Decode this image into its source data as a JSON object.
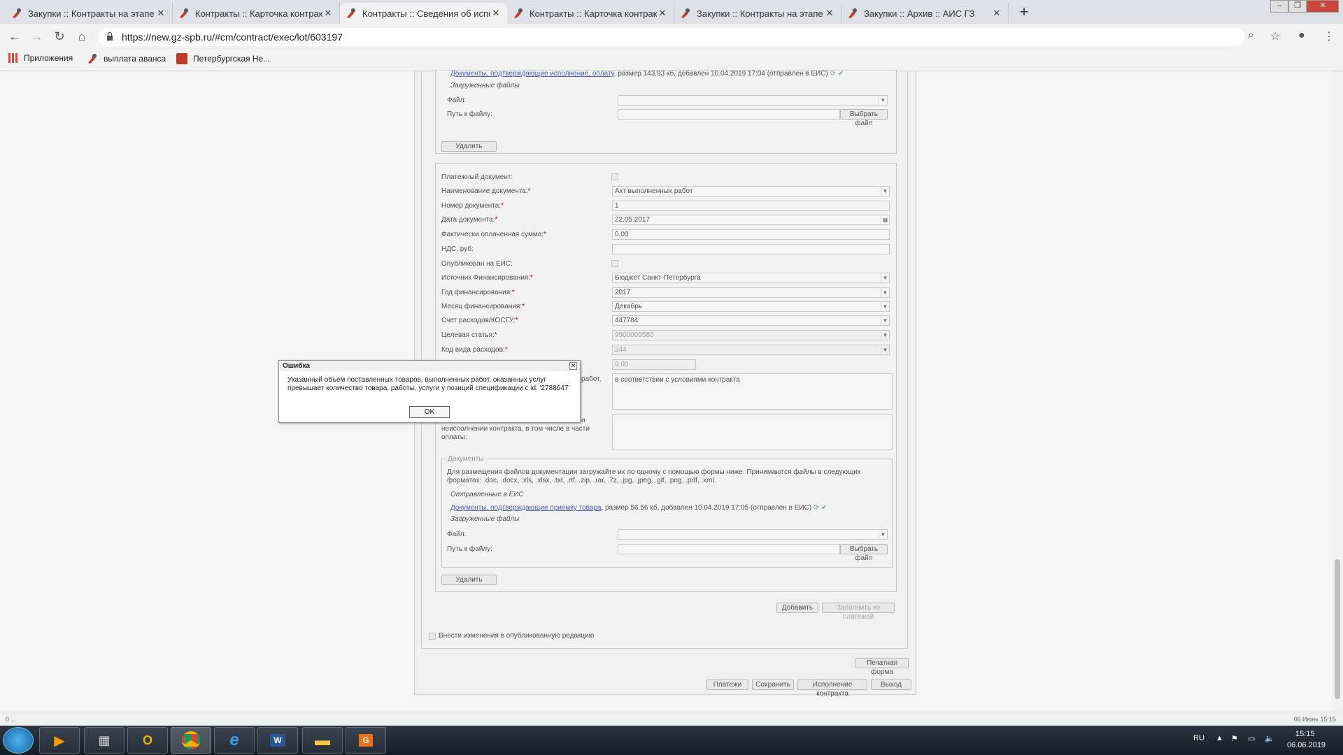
{
  "browser": {
    "tabs": [
      {
        "title": "Закупки :: Контракты на этапе и",
        "active": false
      },
      {
        "title": "Контракты :: Карточка контракта",
        "active": false
      },
      {
        "title": "Контракты :: Сведения об испол",
        "active": true
      },
      {
        "title": "Контракты :: Карточка контракта",
        "active": false
      },
      {
        "title": "Закупки :: Контракты на этапе и",
        "active": false
      },
      {
        "title": "Закупки :: Архив :: АИС ГЗ",
        "active": false
      }
    ],
    "url": "https://new.gz-spb.ru/#cm/contract/exec/lot/603197",
    "bookmarks": [
      "Приложения",
      "выплата аванса",
      "Петербургская Не..."
    ]
  },
  "top_section": {
    "doc_link": "Документы, подтверждающие исполнение, оплату",
    "doc_info": ", размер 143.93 кб, добавлен 10.04.2019 17:04 (отправлен в ЕИС)",
    "uploaded_label": "Загруженные файлы",
    "file_label": "Файл:",
    "path_label": "Путь к файлу:",
    "choose_file": "Выбрать файл",
    "delete": "Удалить"
  },
  "form": {
    "payment_doc_label": "Платежный документ:",
    "doc_name_label": "Наименование документа:",
    "doc_name_value": "Акт выполненных работ",
    "doc_number_label": "Номер документа:",
    "doc_number_value": "1",
    "doc_date_label": "Дата документа:",
    "doc_date_value": "22.05.2017",
    "paid_sum_label": "Фактически оплаченная сумма:",
    "paid_sum_value": "0.00",
    "vat_label": "НДС, руб:",
    "vat_value": "",
    "published_label": "Опубликован на ЕИС:",
    "source_label": "Источник Финансирования:",
    "source_value": "Бюджет Санкт-Петербурга",
    "year_label": "Год финансирования:",
    "year_value": "2017",
    "month_label": "Месяц финансирования:",
    "month_value": "Декабрь",
    "account_label": "Счет расходов/КОСГУ:",
    "account_value": "447784",
    "target_label": "Целевая статья:",
    "target_value": "9900000580",
    "expense_code_label": "Код вида расходов:",
    "expense_code_value": "244",
    "partial_value": "0.00",
    "works_label_tail": "работ,",
    "works_value": "в соответствии с условиями контракта",
    "penalty_label_tail": "и",
    "penalty_label_2": "неисполнении контракта, в том числе в части",
    "penalty_label_3": "оплаты:",
    "penalty_value": ""
  },
  "documents": {
    "legend": "Документы",
    "hint": "Для размещения файлов документации загружайте их по одному с помощью формы ниже. Принимаются файлы в следующих форматах: .doc, .docx, .xls, .xlsx, .txt, .rtf, .zip, .rar, .7z, .jpg, .jpeg, .gif, .png, .pdf, .xml.",
    "sent_label": "Отправленные в ЕИС",
    "doc_link": "Документы, подтверждающие приемку товара",
    "doc_info": ", размер 56.56 кб, добавлен 10.04.2019 17:05 (отправлен в ЕИС)",
    "uploaded_label": "Загруженные файлы",
    "file_label": "Файл:",
    "path_label": "Путь к файлу:",
    "choose_file": "Выбрать файл",
    "delete": "Удалить"
  },
  "actions": {
    "add": "Добавить",
    "fill_from_payments": "Заполнить из платежей",
    "edit_published": "Внести изменения в опубликованную редакцию",
    "print_form": "Печатная форма",
    "payments": "Платежи",
    "save": "Сохранить",
    "contract_execution": "Исполнение контракта",
    "exit": "Выход"
  },
  "dialog": {
    "title": "Ошибка",
    "message": "Указанный объем поставленных товаров, выполненных работ, оказанных услуг превышает количество товара, работы, услуги у позиций спецификации с id: '2788647'",
    "ok": "OK"
  },
  "status": {
    "left": "0 ...",
    "right": "06 Июнь 15:15"
  },
  "tray": {
    "lang": "RU",
    "time": "15:15",
    "date": "06.06.2019"
  },
  "colors": {
    "link": "#4a62c4",
    "required": "#cc0000",
    "tab_active": "#f2f2f2"
  }
}
